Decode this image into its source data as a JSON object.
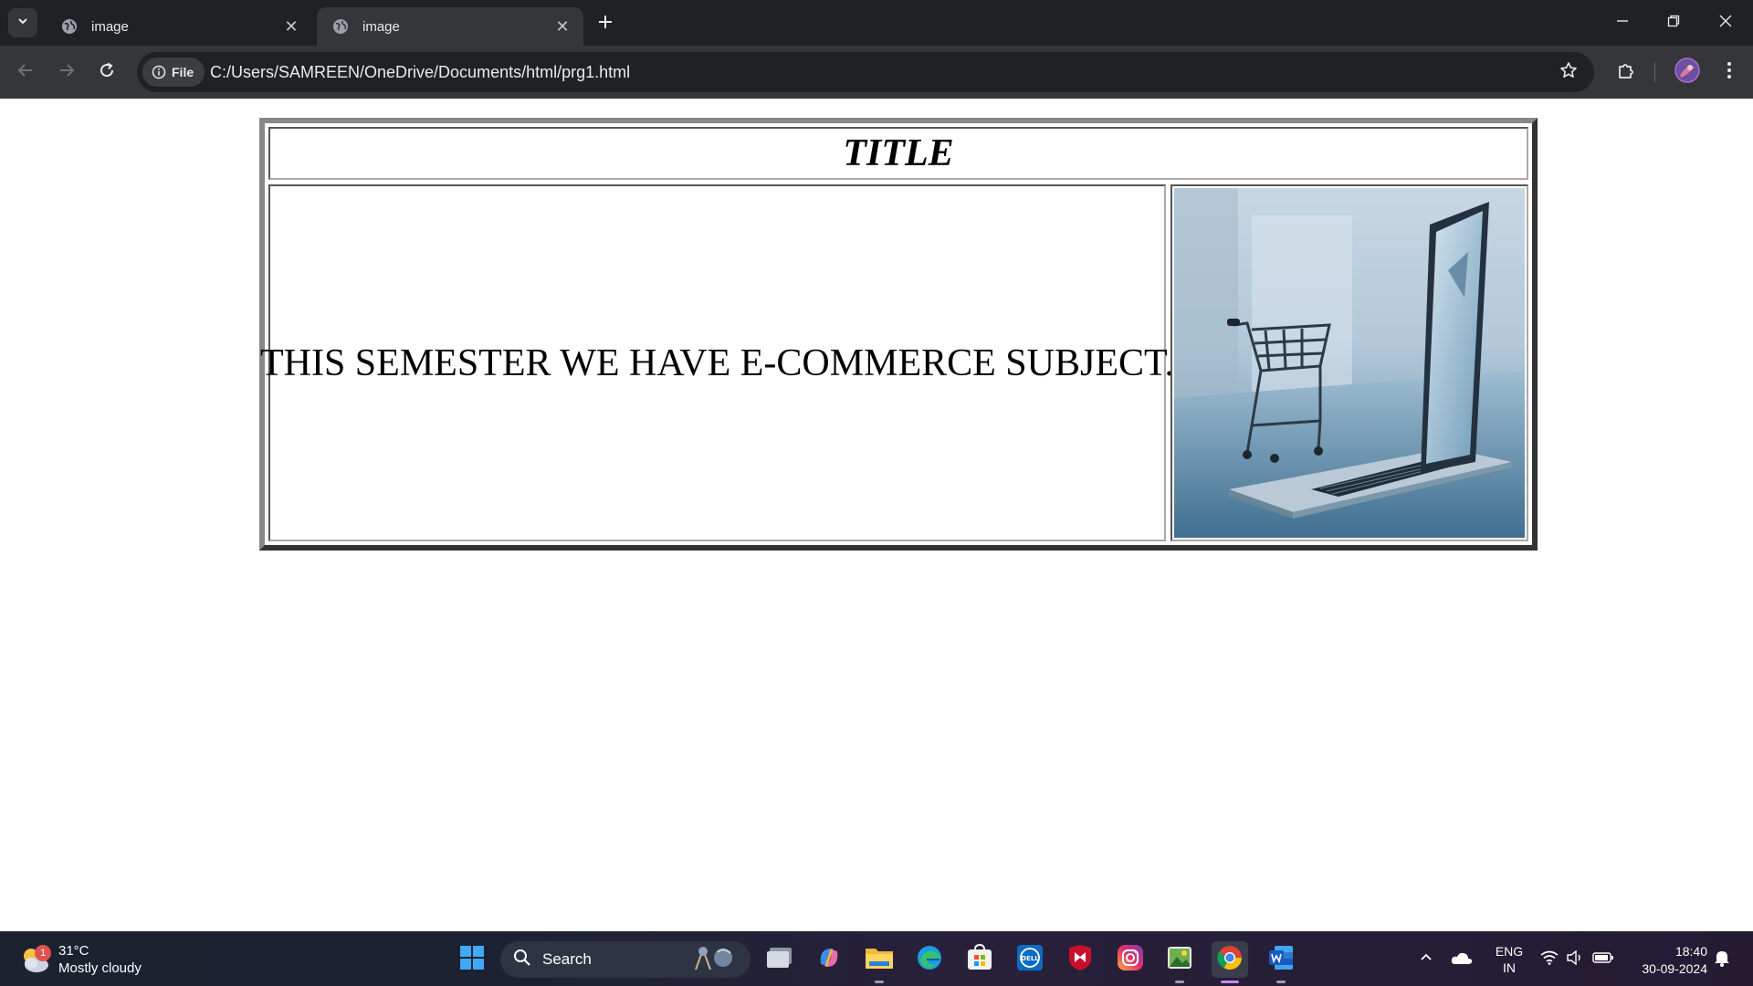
{
  "browser": {
    "tabs": [
      {
        "title": "image"
      },
      {
        "title": "image"
      }
    ],
    "omnibox": {
      "chip_label": "File",
      "url": "C:/Users/SAMREEN/OneDrive/Documents/html/prg1.html"
    }
  },
  "page": {
    "title": "TITLE",
    "body_text": "THIS SEMESTER WE HAVE E-COMMERCE SUBJECT.",
    "image_subject": "laptop with shopping cart"
  },
  "taskbar": {
    "weather": {
      "badge": "1",
      "temp": "31°C",
      "condition": "Mostly cloudy"
    },
    "search_label": "Search",
    "apps": [
      "start-icon",
      "task-view-icon",
      "copilot-icon",
      "file-explorer-icon",
      "edge-icon",
      "microsoft-store-icon",
      "dell-icon",
      "mcafee-icon",
      "instagram-icon",
      "photos-icon",
      "chrome-icon",
      "word-icon"
    ],
    "language": {
      "line1": "ENG",
      "line2": "IN"
    },
    "clock": {
      "time": "18:40",
      "date": "30-09-2024"
    }
  },
  "colors": {
    "tabstrip": "#202124",
    "toolbar": "#35363a",
    "taskbar": "#1d2230"
  }
}
